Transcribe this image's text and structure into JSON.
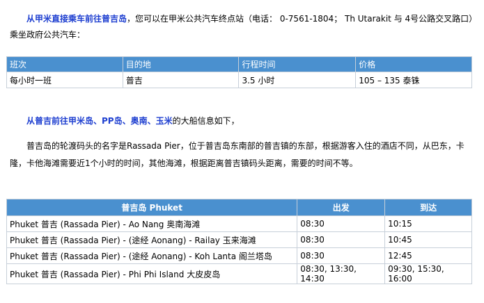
{
  "intro": {
    "highlight": "从甲米直接乘车前往普吉岛",
    "text": "，您可以在甲米公共汽车终点站（电话： 0-7561-1804； Th Utarakit 与 4号公路交叉路口）乘坐政府公共汽车："
  },
  "bus_table": {
    "headers": [
      "班次",
      "目的地",
      "行程时间",
      "价格"
    ],
    "rows": [
      [
        "每小时一班",
        "普吉",
        "3.5 小时",
        "105 – 135 泰铢"
      ]
    ]
  },
  "boat_intro": {
    "highlight": "从普吉前往甲米岛、PP岛、奥南、玉米",
    "text": "的大船信息如下，"
  },
  "pier_paragraph": "普吉岛的轮渡码头的名字是Rassada Pier，位于普吉岛东南部的普吉镇的东部，根据游客入住的酒店不同，从巴东，卡隆，卡他海滩需要近1个小时的时间，其他海滩，根据距离普吉镇码头距离，需要的时间不等。",
  "boat_table": {
    "headers": [
      "普吉岛 Phuket",
      "出发",
      "到达"
    ],
    "rows": [
      [
        "Phuket 普吉 (Rassada Pier) - Ao Nang 奥南海滩",
        "08:30",
        "10:15"
      ],
      [
        "Phuket 普吉 (Rassada Pier) - (途经 Aonang) - Railay 玉来海滩",
        "08:30",
        "10:45"
      ],
      [
        "Phuket 普吉 (Rassada Pier) - (途经 Aonang) - Koh Lanta 阁兰塔岛",
        "08:30",
        "12:45"
      ],
      [
        "Phuket 普吉 (Rassada Pier) - Phi Phi Island 大皮皮岛",
        "08:30, 13:30, 14:30",
        "09:30, 15:30, 16:00"
      ]
    ]
  }
}
